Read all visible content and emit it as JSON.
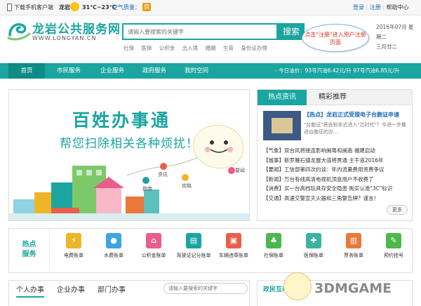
{
  "topbar": {
    "download_label": "下载手机客户端",
    "city": "龙岩",
    "temperature": "31℃~23℃",
    "air_quality_label": "空气质量：",
    "air_quality_value": "良",
    "login": "登录",
    "register": "注册",
    "help": "帮助中心"
  },
  "header": {
    "logo_cn": "龙岩公共服务网",
    "logo_en": "WWW.LONGYAN.CN",
    "search_placeholder": "请输入要搜索的关键字",
    "search_button": "搜索",
    "hot_words": [
      "社保",
      "医保",
      "公积金",
      "出入境",
      "婚姻",
      "生育",
      "身份证办理"
    ],
    "date": "2016年07月 星期二",
    "lunar": "三月廿二",
    "callout": "点击\"注册\"进入用户注册页面"
  },
  "nav": {
    "tabs": [
      "首页",
      "市民服务",
      "企业服务",
      "政府服务",
      "我的空间"
    ],
    "ticker": "- 今日油价：93号汽油6.42元/升    97号汽油6.85元/升"
  },
  "banner": {
    "title": "百姓办事通",
    "subtitle": "帮您扫除相关各种烦扰！",
    "nodes": [
      "资讯",
      "指南",
      "攻略",
      "要闻"
    ]
  },
  "news": {
    "tabs": [
      "热点资讯",
      "精彩推荐"
    ],
    "headline": "【热点】龙岩正式受理电子台胞证申请",
    "headline_summary": "\"台胞证\"将告别本式进入\"芯时代\"？今进一步推进台胞证的办...",
    "items": [
      "【气象】双台风将接连影响闽粤和闽南 福建启动",
      "【城事】新罗雁石镇龙屋大道将贯通 主干道2016年",
      "【要闻】工信部第四次约谈：年内流量费用资费争议",
      "【新闻】万台有线高清电视机顶盒用户不收费了",
      "【消费】买一台高档玩具存安全隐患 购买认准\"3C\"标识",
      "【交通】高速交警宣灭火器和三角警告牌？谨言！"
    ],
    "more": "更多"
  },
  "services": {
    "title_line1": "热点",
    "title_line2": "服务",
    "items": [
      {
        "label": "电费账单",
        "icon": "lightning-icon",
        "color": "#f0b429",
        "glyph": "⚡"
      },
      {
        "label": "水费账单",
        "icon": "water-drop-icon",
        "color": "#3da5e0",
        "glyph": "●"
      },
      {
        "label": "公积金账单",
        "icon": "house-icon",
        "color": "#e95d8a",
        "glyph": "⌂"
      },
      {
        "label": "驾驶证记分账单",
        "icon": "id-card-icon",
        "color": "#1aa5a0",
        "glyph": "▤"
      },
      {
        "label": "车辆违章账单",
        "icon": "car-icon",
        "color": "#e95d4b",
        "glyph": "▣"
      },
      {
        "label": "社保账单",
        "icon": "leaf-icon",
        "color": "#4cb74c",
        "glyph": "♣"
      },
      {
        "label": "医保账单",
        "icon": "medical-icon",
        "color": "#3bb3a3",
        "glyph": "✚"
      },
      {
        "label": "票务账单",
        "icon": "ticket-icon",
        "color": "#e9783a",
        "glyph": "▥"
      },
      {
        "label": "预约挂号",
        "icon": "clipboard-icon",
        "color": "#4cb74c",
        "glyph": "✎"
      }
    ]
  },
  "bottom": {
    "tabs": [
      "个人办事",
      "企业办事",
      "部门办事"
    ],
    "search_placeholder": "请输入要搜索的关键字",
    "civic_title": "政民互动"
  },
  "watermark": "3DMGAME",
  "colors": {
    "primary": "#1aa5a0",
    "link": "#1c6bb3",
    "callout_text": "#dd3322"
  }
}
